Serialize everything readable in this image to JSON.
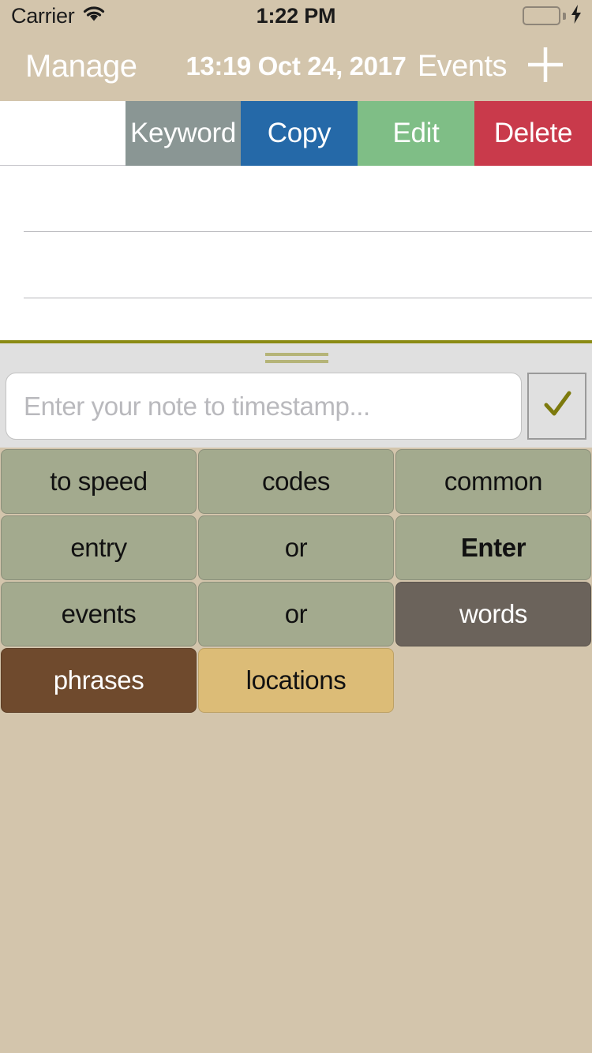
{
  "status_bar": {
    "carrier": "Carrier",
    "wifi_icon": "wifi-icon",
    "time": "1:22 PM",
    "battery_icon": "battery-full-icon",
    "charging_icon": "lightning-bolt-icon"
  },
  "nav_bar": {
    "back_label": "Manage",
    "title": "13:19 Oct 24, 2017",
    "right_label": "Events",
    "add_icon": "plus-icon"
  },
  "action_row": {
    "buttons": [
      {
        "label": "Keyword",
        "color": "#8A9694"
      },
      {
        "label": "Copy",
        "color": "#2569A8"
      },
      {
        "label": "Edit",
        "color": "#7FBE86"
      },
      {
        "label": "Delete",
        "color": "#C93A4B"
      }
    ]
  },
  "accessory": {
    "grabber_icon": "drag-handle-icon",
    "input_placeholder": "Enter your note to timestamp...",
    "input_value": "",
    "confirm_icon": "checkmark-icon",
    "confirm_color": "#7D7A0D"
  },
  "keyword_pad": {
    "rows": [
      [
        {
          "label": "to speed",
          "style": "k-sage",
          "bold": false
        },
        {
          "label": "codes",
          "style": "k-sage",
          "bold": false
        },
        {
          "label": "common",
          "style": "k-sage",
          "bold": false
        }
      ],
      [
        {
          "label": "entry",
          "style": "k-sage",
          "bold": false
        },
        {
          "label": "or",
          "style": "k-sage",
          "bold": false
        },
        {
          "label": "Enter",
          "style": "k-sage",
          "bold": true
        }
      ],
      [
        {
          "label": "events",
          "style": "k-sage",
          "bold": false
        },
        {
          "label": "or",
          "style": "k-sage",
          "bold": false
        },
        {
          "label": "words",
          "style": "k-dark",
          "bold": false
        }
      ],
      [
        {
          "label": "phrases",
          "style": "k-brown",
          "bold": false
        },
        {
          "label": "locations",
          "style": "k-tan",
          "bold": false
        },
        {
          "label": "",
          "style": "empty",
          "bold": false
        }
      ]
    ]
  },
  "theme": {
    "page_background": "#D3C5AC",
    "panel_background": "#E0E0E0",
    "divider_olive": "#8B8B14",
    "list_background": "#ffffff"
  }
}
